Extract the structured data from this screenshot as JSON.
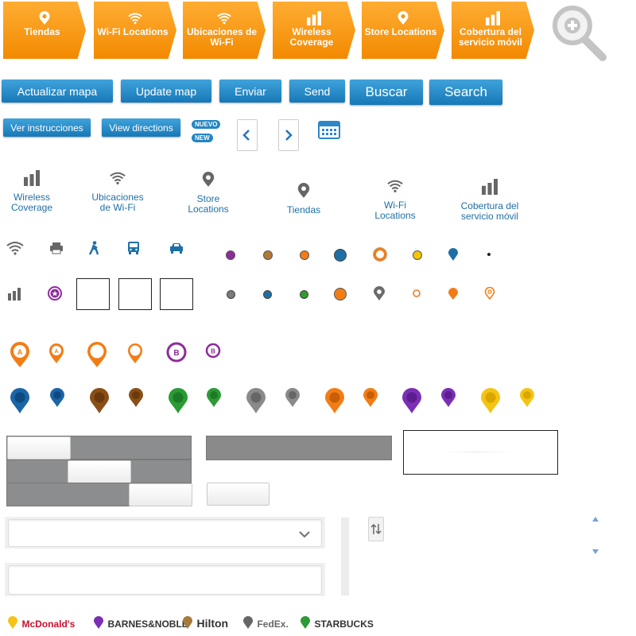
{
  "tabs": [
    {
      "label": "Tiendas",
      "icon": "pin-icon"
    },
    {
      "label": "Wi-Fi Locations",
      "icon": "wifi-icon"
    },
    {
      "label": "Ubicaciones de Wi-Fi",
      "icon": "wifi-icon"
    },
    {
      "label": "Wireless Coverage",
      "icon": "bars-icon"
    },
    {
      "label": "Store Locations",
      "icon": "pin-icon"
    },
    {
      "label": "Cobertura del servicio móvil",
      "icon": "bars-icon"
    }
  ],
  "zoom_icon": "zoom-in-icon",
  "buttons": {
    "actualizar": "Actualizar mapa",
    "update": "Update map",
    "enviar": "Enviar",
    "send": "Send",
    "buscar": "Buscar",
    "search": "Search",
    "ver": "Ver instrucciones",
    "view": "View directions"
  },
  "badges": {
    "nuevo": "NUEVO",
    "new": "NEW"
  },
  "gray_tabs": [
    {
      "label": "Wireless Coverage",
      "icon": "bars-icon"
    },
    {
      "label": "Ubicaciones de Wi-Fi",
      "icon": "wifi-icon"
    },
    {
      "label": "Store Locations",
      "icon": "pin-icon"
    },
    {
      "label": "Tiendas",
      "icon": "pin-icon"
    },
    {
      "label": "Wi-Fi Locations",
      "icon": "wifi-icon"
    },
    {
      "label": "Cobertura del servicio móvil",
      "icon": "bars-icon"
    }
  ],
  "small_icons_row1": [
    "wifi-icon",
    "printer-icon",
    "walk-icon",
    "bus-icon",
    "car-icon"
  ],
  "small_icons_row2": [
    "bars-icon",
    "star-badge-icon"
  ],
  "markers_row1": [
    "purple",
    "brown",
    "orange",
    "blue-large",
    "orange-ring",
    "yellow",
    "blue-pin",
    "black-dot"
  ],
  "markers_row2": [
    "gray",
    "blue",
    "green",
    "orange-large",
    "gray-pin",
    "orange-ring-small",
    "orange-pin",
    "orange-outline-pin"
  ],
  "letter_pins": {
    "a": "A",
    "b": "B"
  },
  "colors": {
    "orange": "#f28a00",
    "blue": "#1778b7",
    "purple": "#8e2b9c",
    "brown": "#9c6a2e",
    "green": "#2f9a2f",
    "gray": "#8a8a8a",
    "yellow": "#f7c500",
    "darkblue": "#155f9a",
    "link": "#1e6fa6"
  },
  "color_pins": [
    {
      "color": "#1b65a8",
      "dark": "#0e4a80"
    },
    {
      "color": "#1b65a8",
      "dark": "#0e4a80"
    },
    {
      "color": "#8a4f17",
      "dark": "#6a3a0e"
    },
    {
      "color": "#8a4f17",
      "dark": "#6a3a0e"
    },
    {
      "color": "#2c9a35",
      "dark": "#1c7a25"
    },
    {
      "color": "#2c9a35",
      "dark": "#1c7a25"
    },
    {
      "color": "#8a8a8a",
      "dark": "#666666"
    },
    {
      "color": "#8a8a8a",
      "dark": "#666666"
    },
    {
      "color": "#f27d16",
      "dark": "#c85e05"
    },
    {
      "color": "#f27d16",
      "dark": "#c85e05"
    },
    {
      "color": "#7a2fb5",
      "dark": "#5c1d91"
    },
    {
      "color": "#7a2fb5",
      "dark": "#5c1d91"
    },
    {
      "color": "#f4c415",
      "dark": "#d9a600"
    },
    {
      "color": "#f4c415",
      "dark": "#d9a600"
    }
  ],
  "brands": [
    {
      "name": "McDonald's",
      "pin": "#f4c415",
      "color": "#c8102e"
    },
    {
      "name": "BARNES&NOBLE",
      "pin": "#7a2fb5",
      "color": "#333333"
    },
    {
      "name": "Hilton",
      "pin": "#a57a3c",
      "color": "#333333"
    },
    {
      "name": "FedEx.",
      "pin": "#666666",
      "color": "#666666"
    },
    {
      "name": "STARBUCKS",
      "pin": "#2c9a35",
      "color": "#333333"
    }
  ]
}
